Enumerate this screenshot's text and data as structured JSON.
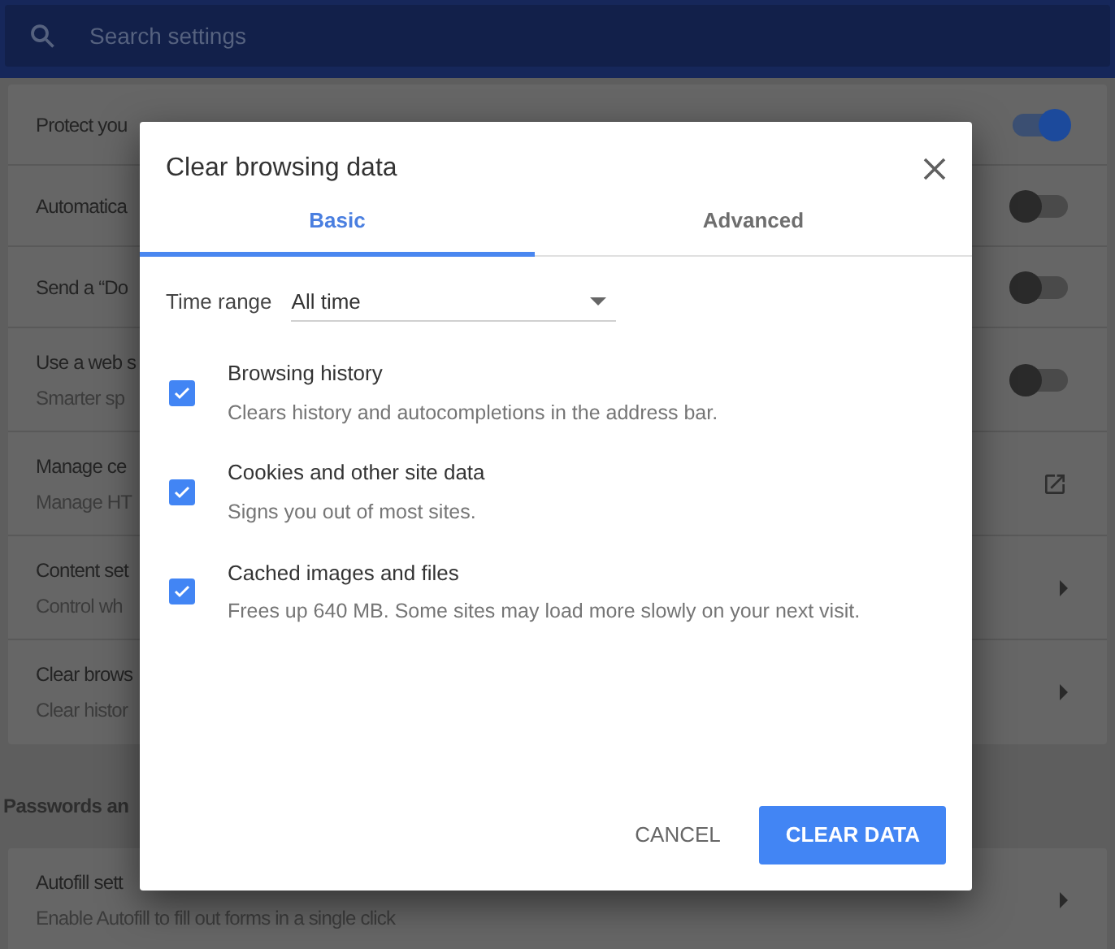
{
  "search": {
    "placeholder": "Search settings"
  },
  "settings_rows": [
    {
      "title": "Protect you",
      "kind": "toggle",
      "on": true
    },
    {
      "title": "Automatica",
      "kind": "toggle",
      "on": false
    },
    {
      "title": "Send a “Do",
      "kind": "toggle",
      "on": false
    },
    {
      "title": "Use a web s",
      "subtitle": "Smarter sp",
      "kind": "toggle",
      "on": false
    },
    {
      "title": "Manage ce",
      "subtitle": "Manage HT",
      "kind": "external"
    },
    {
      "title": "Content set",
      "subtitle": "Control wh",
      "kind": "arrow"
    },
    {
      "title": "Clear brows",
      "subtitle": "Clear histor",
      "kind": "arrow"
    }
  ],
  "section_heading": "Passwords an",
  "section_rows": [
    {
      "title": "Autofill sett",
      "subtitle": "Enable Autofill to fill out forms in a single click",
      "kind": "arrow"
    }
  ],
  "dialog": {
    "title": "Clear browsing data",
    "tabs": [
      {
        "label": "Basic",
        "selected": true
      },
      {
        "label": "Advanced",
        "selected": false
      }
    ],
    "time_range": {
      "label": "Time range",
      "value": "All time"
    },
    "options": [
      {
        "title": "Browsing history",
        "description": "Clears history and autocompletions in the address bar.",
        "checked": true
      },
      {
        "title": "Cookies and other site data",
        "description": "Signs you out of most sites.",
        "checked": true
      },
      {
        "title": "Cached images and files",
        "description": "Frees up 640 MB. Some sites may load more slowly on your next visit.",
        "checked": true
      }
    ],
    "buttons": [
      {
        "label": "CANCEL",
        "kind": "text"
      },
      {
        "label": "CLEAR DATA",
        "kind": "primary"
      }
    ]
  }
}
